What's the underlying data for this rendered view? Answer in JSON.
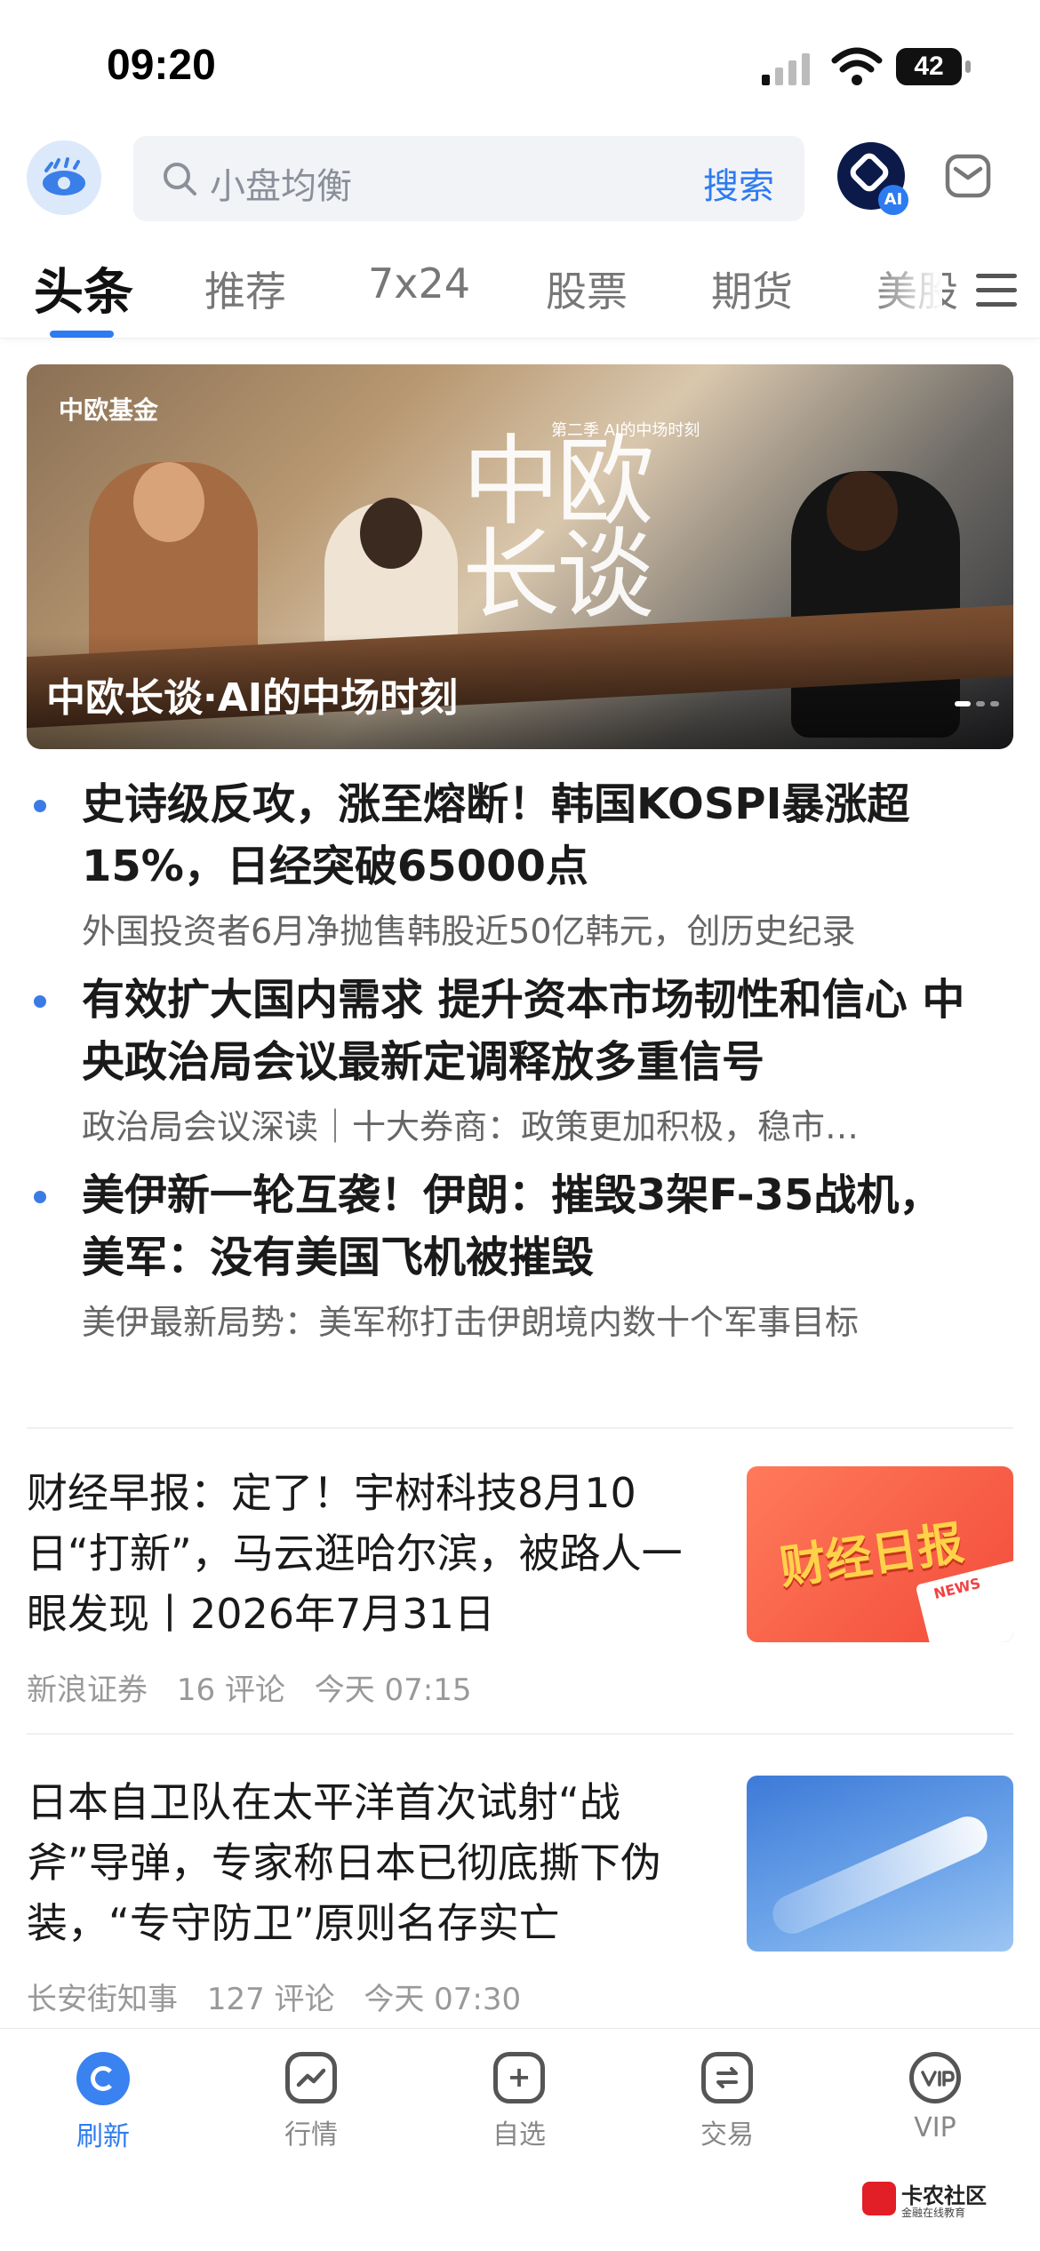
{
  "status_bar": {
    "time": "09:20",
    "battery": "42"
  },
  "search": {
    "placeholder": "小盘均衡",
    "button": "搜索"
  },
  "ai_badge": "AI",
  "tabs": [
    "头条",
    "推荐",
    "7x24",
    "股票",
    "期货",
    "美股"
  ],
  "banner": {
    "caption": "中欧长谈·AI的中场时刻",
    "show_title": "中欧长谈",
    "season": "第二季 AI的中场时刻",
    "brand": "中欧基金"
  },
  "headlines": [
    {
      "title": "史诗级反攻，涨至熔断！韩国KOSPI暴涨超15%，日经突破65000点",
      "sub": "外国投资者6月净抛售韩股近50亿韩元，创历史纪录"
    },
    {
      "title": "有效扩大国内需求 提升资本市场韧性和信心 中央政治局会议最新定调释放多重信号",
      "sub": "政治局会议深读｜十大券商：政策更加积极，稳市…"
    },
    {
      "title": "美伊新一轮互袭！伊朗：摧毁3架F-35战机，美军：没有美国飞机被摧毁",
      "sub": "美伊最新局势：美军称打击伊朗境内数十个军事目标"
    }
  ],
  "cards": [
    {
      "title": "财经早报：定了！宇树科技8月10日“打新”，马云逛哈尔滨，被路人一眼发现丨2026年7月31日",
      "source": "新浪证券",
      "comments": "16 评论",
      "time": "今天 07:15",
      "thumb_text": "财经日报",
      "thumb_badge": "NEWS"
    },
    {
      "title": "日本自卫队在太平洋首次试射“战斧”导弹，专家称日本已彻底撕下伪装，“专守防卫”原则名存实亡",
      "source": "长安街知事",
      "comments": "127 评论",
      "time": "今天 07:30"
    }
  ],
  "bottom_nav": [
    "刷新",
    "行情",
    "自选",
    "交易",
    "VIP"
  ],
  "watermark": {
    "name": "卡农社区",
    "sub": "金融在线教育"
  },
  "colors": {
    "accent": "#2d7bf0",
    "dot": "#3b7be6"
  }
}
